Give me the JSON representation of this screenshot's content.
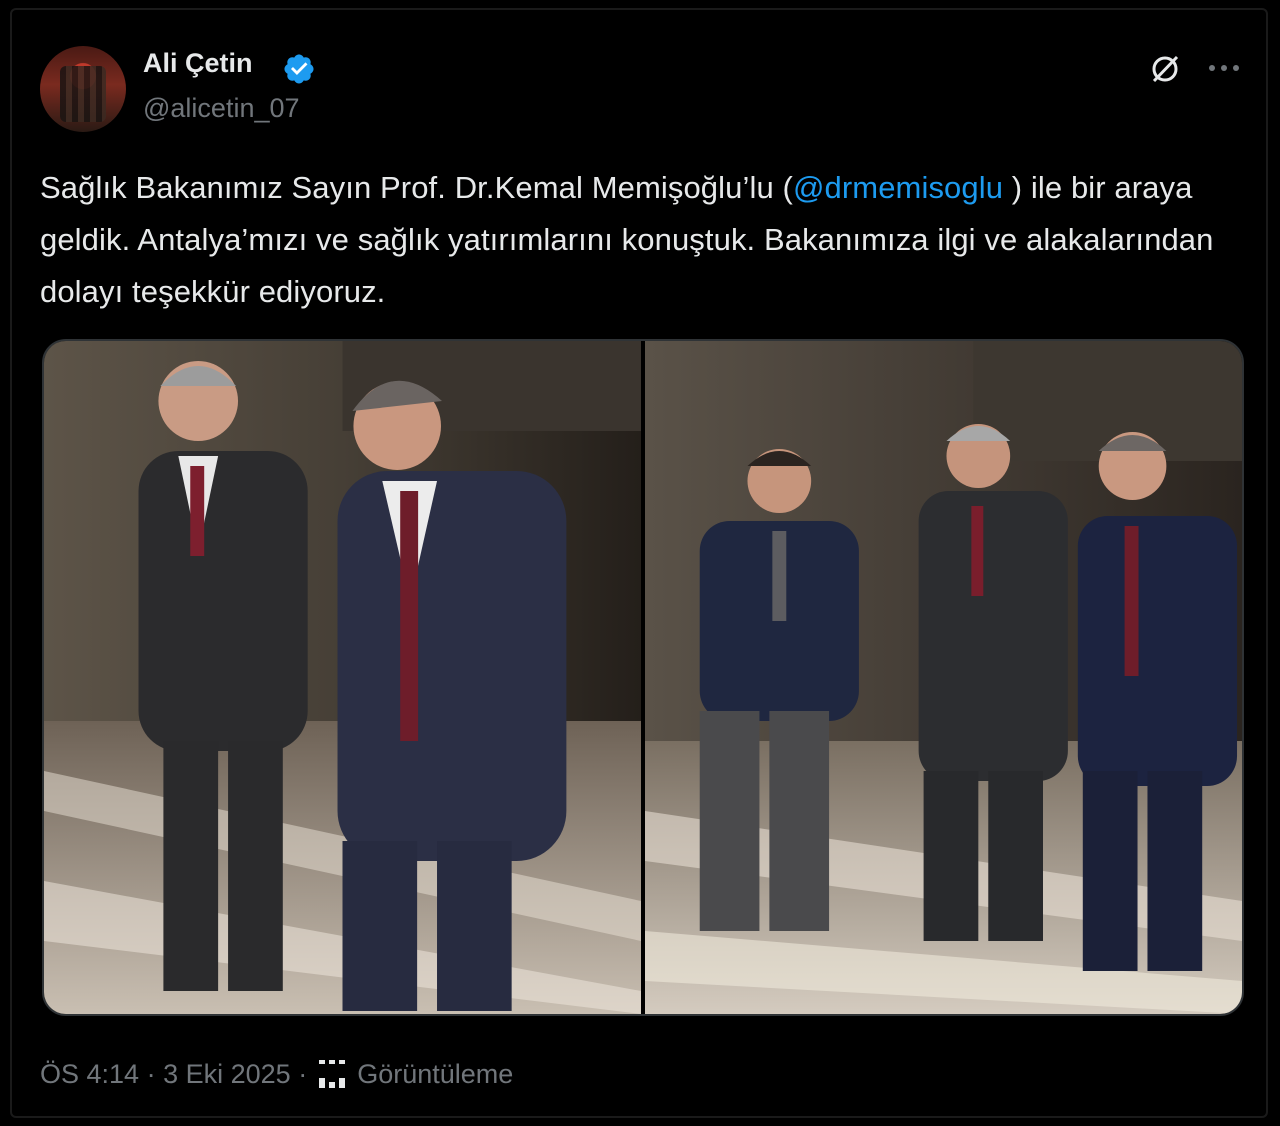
{
  "author": {
    "name": "Ali Çetin",
    "handle": "@alicetin_07",
    "verified_icon": "verified-badge-icon",
    "verified_color": "#1d9bf0"
  },
  "header_actions": {
    "grok_icon": "grok-icon",
    "more_icon": "more-icon"
  },
  "tweet": {
    "text_before": "Sağlık Bakanımız Sayın Prof. Dr.Kemal Memişoğlu’lu (",
    "mention": "@drmemisoglu",
    "text_after": " ) ile bir araya geldik. Antalya’mızı ve sağlık yatırımlarını konuştuk. Bakanımıza ilgi ve alakalarından dolayı teşekkür ediyoruz."
  },
  "media": {
    "count": 2
  },
  "meta": {
    "time": "ÖS 4:14",
    "separator": "·",
    "date": "3 Eki 2025",
    "separator2": "·",
    "views_label": "Görüntüleme",
    "views_icon": "views-icon"
  },
  "colors": {
    "background": "#000000",
    "text": "#e7e9ea",
    "secondary": "#71767b",
    "accent": "#1d9bf0"
  }
}
